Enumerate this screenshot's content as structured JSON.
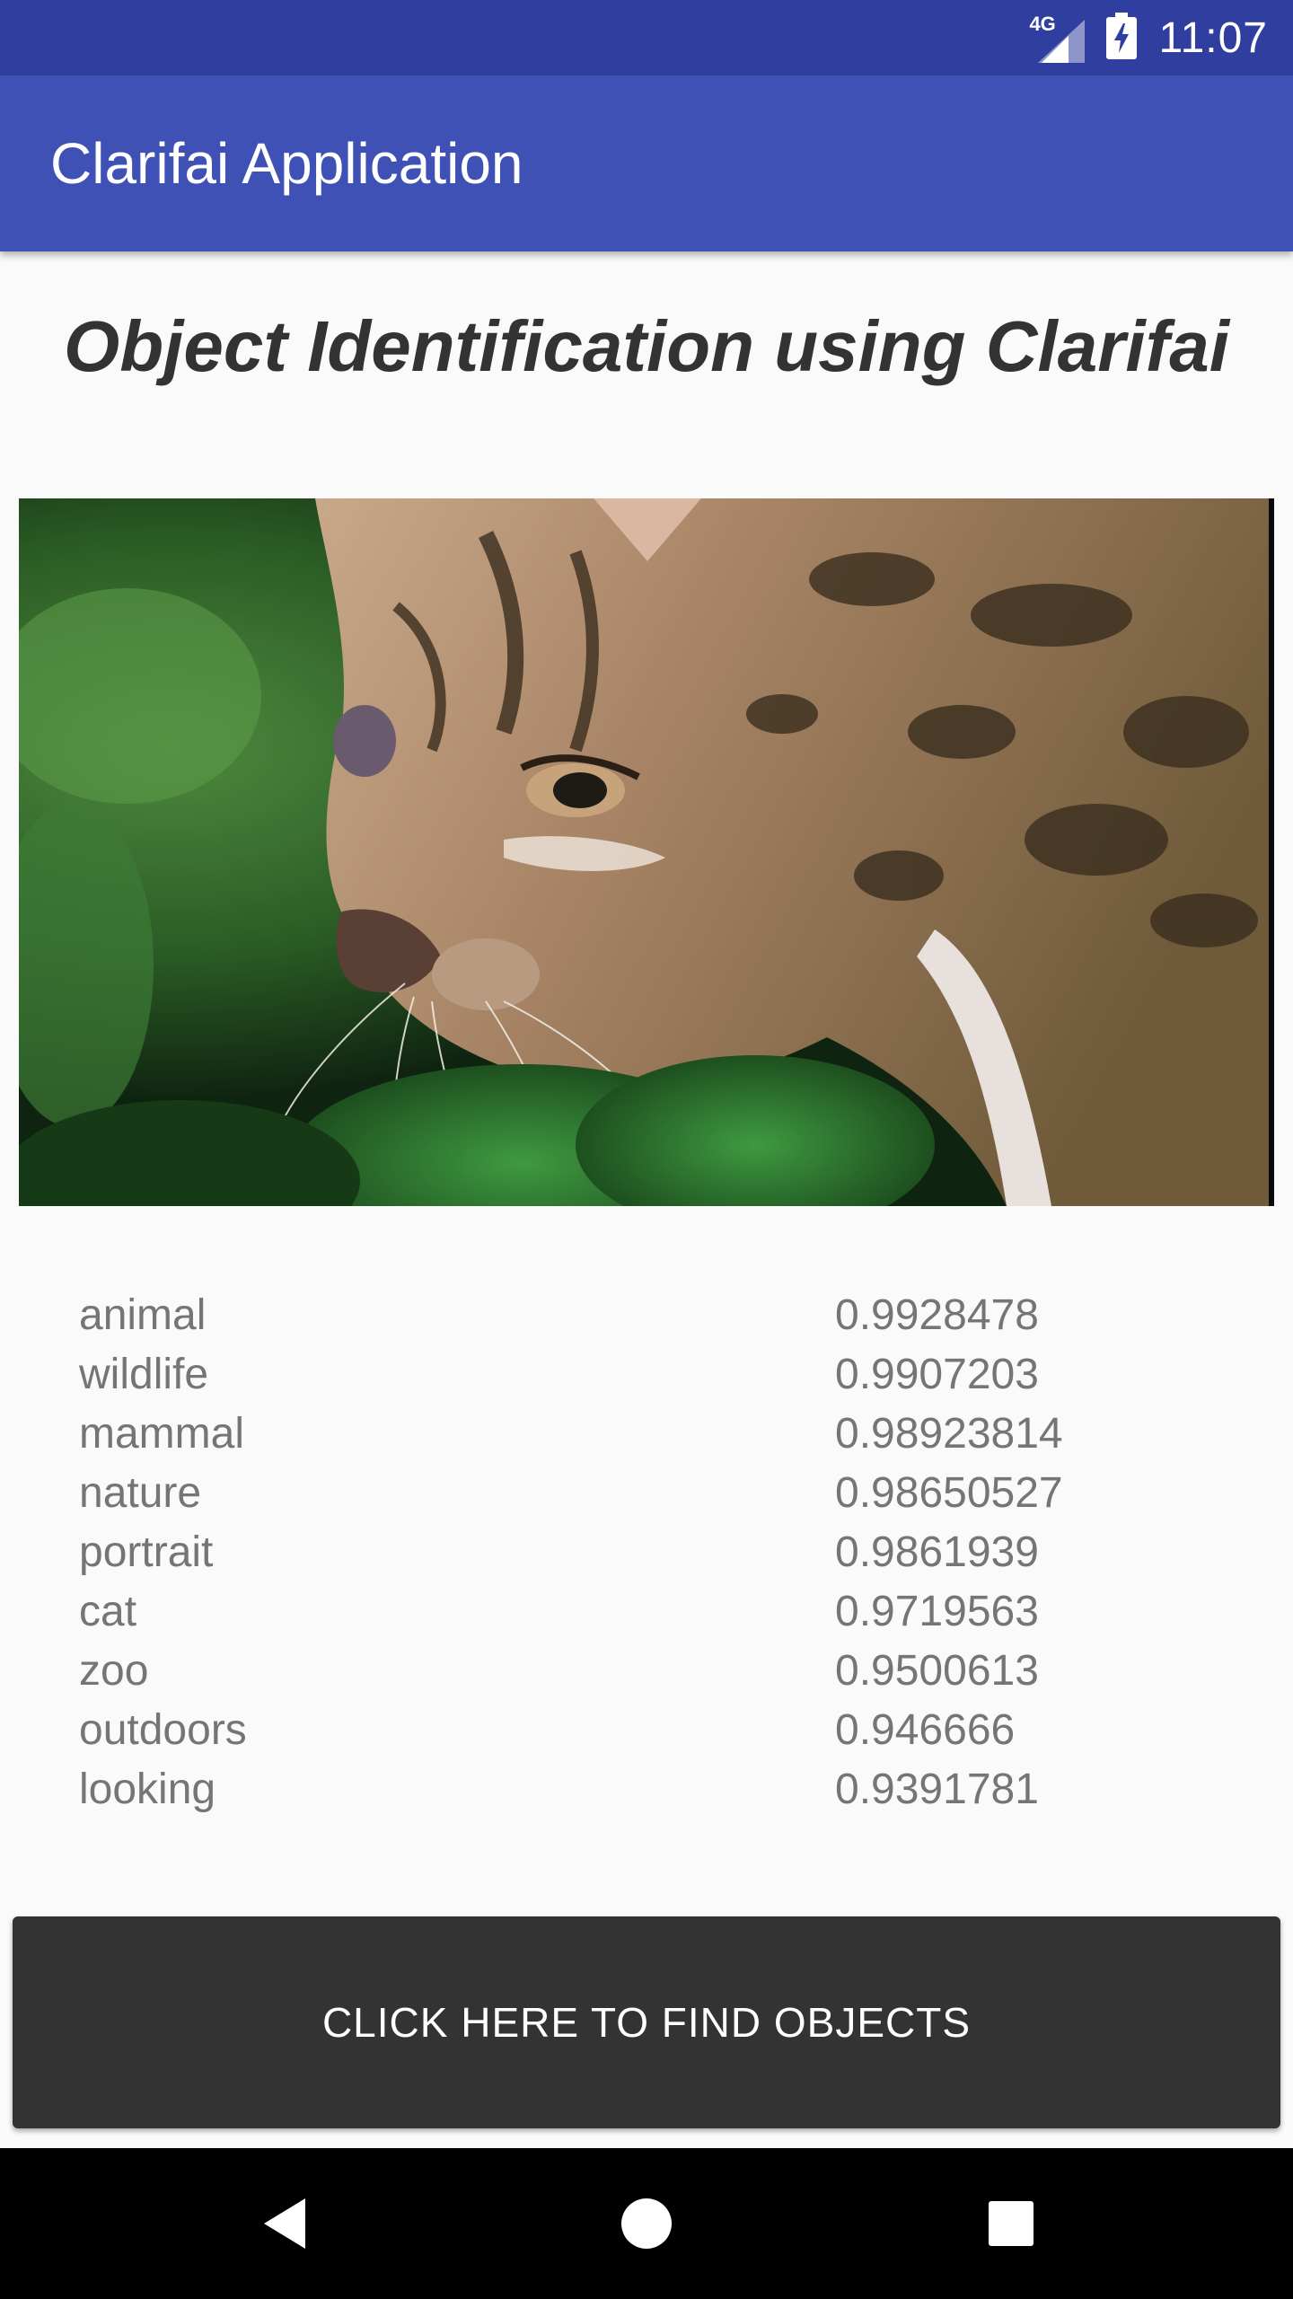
{
  "status_bar": {
    "network_label": "4G",
    "time": "11:07"
  },
  "app_bar": {
    "title": "Clarifai Application"
  },
  "heading": "Object Identification using Clarifai",
  "image": {
    "icon": "ocelot-photo"
  },
  "results": [
    {
      "label": "animal",
      "score": "0.9928478"
    },
    {
      "label": "wildlife",
      "score": "0.9907203"
    },
    {
      "label": "mammal",
      "score": "0.98923814"
    },
    {
      "label": "nature",
      "score": "0.98650527"
    },
    {
      "label": "portrait",
      "score": "0.9861939"
    },
    {
      "label": "cat",
      "score": "0.9719563"
    },
    {
      "label": "zoo",
      "score": "0.9500613"
    },
    {
      "label": "outdoors",
      "score": "0.946666"
    },
    {
      "label": "looking",
      "score": "0.9391781"
    }
  ],
  "find_button_label": "CLICK HERE TO FIND OBJECTS",
  "nav_bar": {
    "back_icon": "back-icon",
    "home_icon": "home-icon",
    "recents_icon": "recents-icon"
  },
  "colors": {
    "status_bar": "#303f9f",
    "app_bar": "#3f51b5",
    "button": "#333333"
  }
}
